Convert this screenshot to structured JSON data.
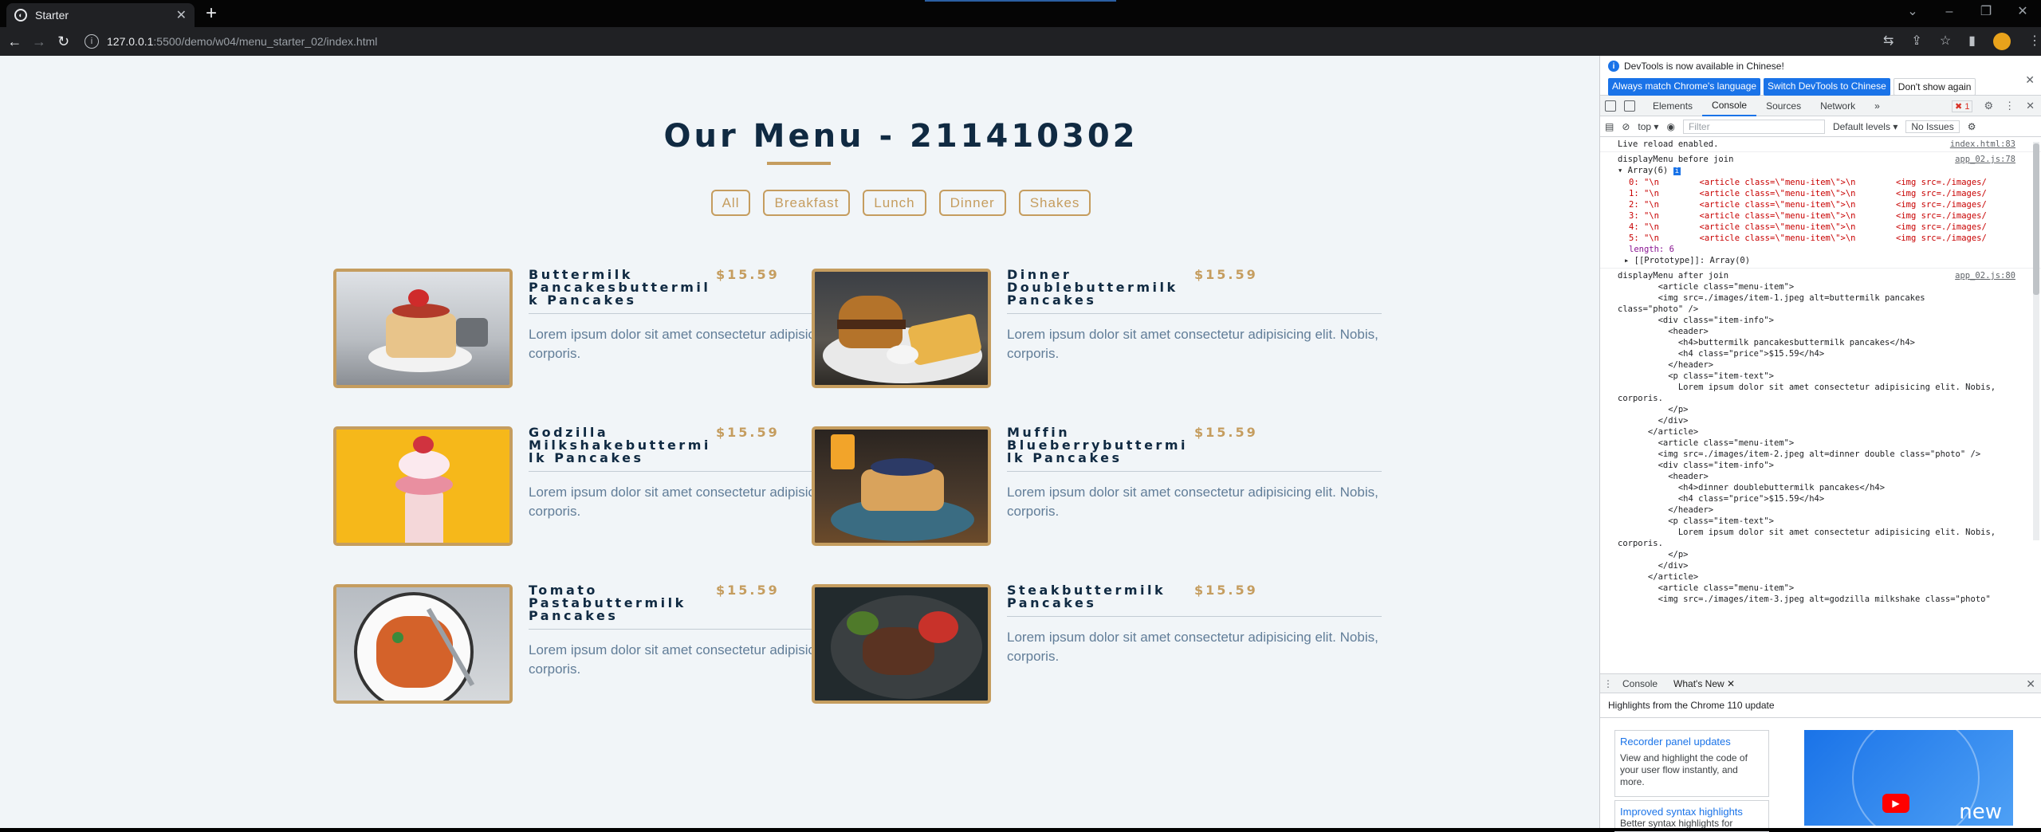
{
  "browser": {
    "tab_title": "Starter",
    "url_host": "127.0.0.1",
    "url_path": ":5500/demo/w04/menu_starter_02/index.html"
  },
  "page": {
    "title": "Our Menu - 211410302",
    "filters": [
      "All",
      "Breakfast",
      "Lunch",
      "Dinner",
      "Shakes"
    ],
    "items": [
      {
        "name": "Buttermilk Pancakesbuttermilk Pancakes",
        "price": "$15.59",
        "text": "Lorem ipsum dolor sit amet consectetur adipisicing elit. Nobis, corporis.",
        "image": "pancakes-photo"
      },
      {
        "name": "Dinner Doublebuttermilk Pancakes",
        "price": "$15.59",
        "text": "Lorem ipsum dolor sit amet consectetur adipisicing elit. Nobis, corporis.",
        "image": "burger-photo"
      },
      {
        "name": "Godzilla Milkshakebuttermilk Pancakes",
        "price": "$15.59",
        "text": "Lorem ipsum dolor sit amet consectetur adipisicing elit. Nobis, corporis.",
        "image": "milkshake-photo"
      },
      {
        "name": "Muffin Blueberrybuttermilk Pancakes",
        "price": "$15.59",
        "text": "Lorem ipsum dolor sit amet consectetur adipisicing elit. Nobis, corporis.",
        "image": "blueberry-pancakes-photo"
      },
      {
        "name": "Tomato Pastabuttermilk Pancakes",
        "price": "$15.59",
        "text": "Lorem ipsum dolor sit amet consectetur adipisicing elit. Nobis, corporis.",
        "image": "pasta-photo"
      },
      {
        "name": "Steakbuttermilk Pancakes",
        "price": "$15.59",
        "text": "Lorem ipsum dolor sit amet consectetur adipisicing elit. Nobis, corporis.",
        "image": "steak-photo"
      }
    ]
  },
  "devtools": {
    "banner": "DevTools is now available in Chinese!",
    "banner_btn1": "Always match Chrome's language",
    "banner_btn2": "Switch DevTools to Chinese",
    "banner_btn3": "Don't show again",
    "tabs": [
      "Elements",
      "Console",
      "Sources",
      "Network"
    ],
    "active_tab": "Console",
    "error_count": "1",
    "context": "top",
    "filter_placeholder": "Filter",
    "levels": "Default levels",
    "issues": "No Issues",
    "console": {
      "line1": "Live reload enabled.",
      "line1_src": "index.html:83",
      "line2": "displayMenu before join",
      "line2_src": "app_02.js:78",
      "array_label": "Array(6)",
      "array_items": [
        "0: \"\\n        <article class=\\\"menu-item\\\">\\n        <img src=./images/",
        "1: \"\\n        <article class=\\\"menu-item\\\">\\n        <img src=./images/",
        "2: \"\\n        <article class=\\\"menu-item\\\">\\n        <img src=./images/",
        "3: \"\\n        <article class=\\\"menu-item\\\">\\n        <img src=./images/",
        "4: \"\\n        <article class=\\\"menu-item\\\">\\n        <img src=./images/",
        "5: \"\\n        <article class=\\\"menu-item\\\">\\n        <img src=./images/"
      ],
      "length": "length: 6",
      "prototype": "[[Prototype]]: Array(0)",
      "line3": "displayMenu after join",
      "line3_src": "app_02.js:80",
      "html_dump": [
        "        <article class=\"menu-item\">",
        "        <img src=./images/item-1.jpeg alt=buttermilk pancakes",
        "class=\"photo\" />",
        "        <div class=\"item-info\">",
        "          <header>",
        "            <h4>buttermilk pancakesbuttermilk pancakes</h4>",
        "            <h4 class=\"price\">$15.59</h4>",
        "          </header>",
        "          <p class=\"item-text\">",
        "            Lorem ipsum dolor sit amet consectetur adipisicing elit. Nobis,",
        "corporis.",
        "          </p>",
        "        </div>",
        "      </article>",
        "",
        "        <article class=\"menu-item\">",
        "        <img src=./images/item-2.jpeg alt=dinner double class=\"photo\" />",
        "        <div class=\"item-info\">",
        "          <header>",
        "            <h4>dinner doublebuttermilk pancakes</h4>",
        "            <h4 class=\"price\">$15.59</h4>",
        "          </header>",
        "          <p class=\"item-text\">",
        "            Lorem ipsum dolor sit amet consectetur adipisicing elit. Nobis,",
        "corporis.",
        "          </p>",
        "        </div>",
        "      </article>",
        "",
        "        <article class=\"menu-item\">",
        "        <img src=./images/item-3.jpeg alt=godzilla milkshake class=\"photo\""
      ]
    },
    "drawer": {
      "tabs": [
        "Console",
        "What's New"
      ],
      "title": "Highlights from the Chrome 110 update",
      "card1_title": "Recorder panel updates",
      "card1_text": "View and highlight the code of your user flow instantly, and more.",
      "card2_title": "Improved syntax highlights",
      "card2_text": "Better syntax highlights for",
      "video_label": "new"
    }
  }
}
